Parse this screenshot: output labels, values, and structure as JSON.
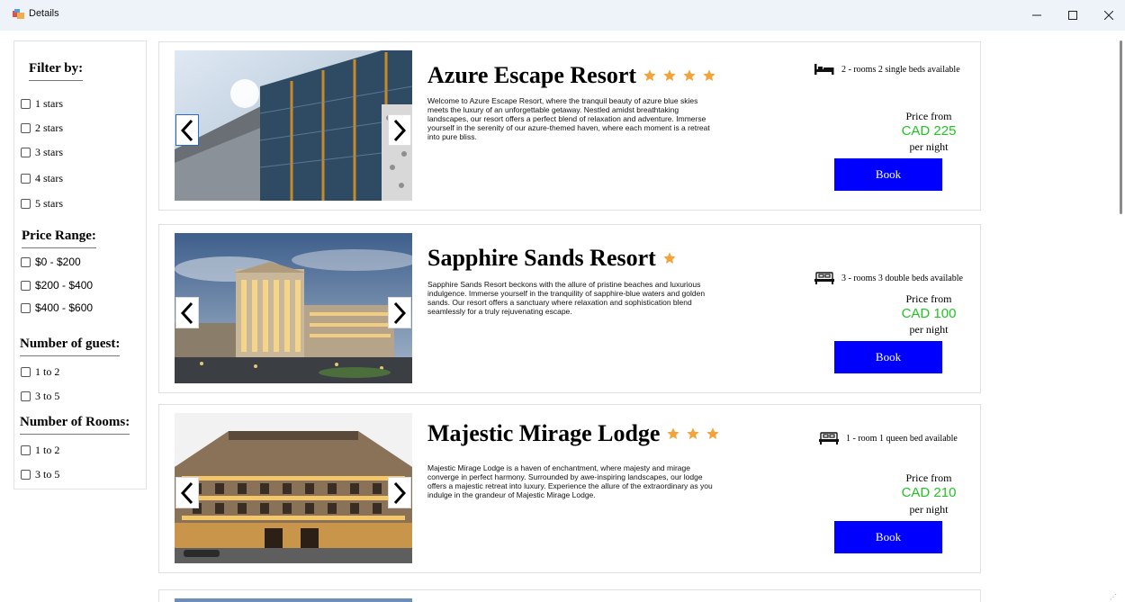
{
  "window": {
    "title": "Details",
    "icon": "app-icon",
    "controls": [
      "minimize-icon",
      "maximize-icon",
      "close-icon"
    ]
  },
  "filters": {
    "heading": "Filter by:",
    "stars": [
      "1 stars",
      "2 stars",
      "3 stars",
      "4 stars",
      "5 stars"
    ],
    "price_heading": "Price Range:",
    "price": [
      "$0 - $200",
      "$200 - $400",
      "$400 - $600"
    ],
    "guest_heading": "Number of guest:",
    "guests": [
      "1 to 2",
      "3 to 5"
    ],
    "rooms_heading": "Number of Rooms:",
    "rooms": [
      "1 to 2",
      "3 to 5"
    ]
  },
  "hotels": [
    {
      "name": "Azure Escape Resort",
      "stars": 4,
      "description": "Welcome to Azure Escape Resort, where the tranquil beauty of azure blue skies meets the luxury of an unforgettable getaway. Nestled amidst breathtaking landscapes, our resort offers a perfect blend of relaxation and adventure. Immerse yourself in the serenity of our azure-themed haven, where each moment is a retreat into pure bliss.",
      "availability": "2 - rooms 2 single beds available",
      "bed_icon": "single-bed-icon",
      "price_from": "Price from",
      "price": "CAD 225",
      "per_night": "per night",
      "book": "Book"
    },
    {
      "name": "Sapphire Sands Resort",
      "stars": 1,
      "description": "Sapphire Sands Resort beckons with the allure of pristine beaches and luxurious indulgence. Immerse yourself in the tranquility of sapphire-blue waters and golden sands. Our resort offers a sanctuary where relaxation and sophistication blend seamlessly for a truly rejuvenating escape.",
      "availability": "3 - rooms 3 double beds available",
      "bed_icon": "double-bed-icon",
      "price_from": "Price from",
      "price": "CAD 100",
      "per_night": "per night",
      "book": "Book"
    },
    {
      "name": "Majestic Mirage Lodge",
      "stars": 3,
      "description": "Majestic Mirage Lodge is a haven of enchantment, where majesty and mirage converge in perfect harmony. Surrounded by awe-inspiring landscapes, our lodge offers a majestic retreat into luxury. Experience the allure of the extraordinary as you indulge in the grandeur of Majestic Mirage Lodge.",
      "availability": "1 - room 1 queen bed available",
      "bed_icon": "queen-bed-icon",
      "price_from": "Price from",
      "price": "CAD 210",
      "per_night": "per night",
      "book": "Book"
    }
  ],
  "colors": {
    "star": "#f4a23a",
    "price": "#22c322",
    "book_button": "#0000ff",
    "titlebar": "#eef3f9"
  }
}
